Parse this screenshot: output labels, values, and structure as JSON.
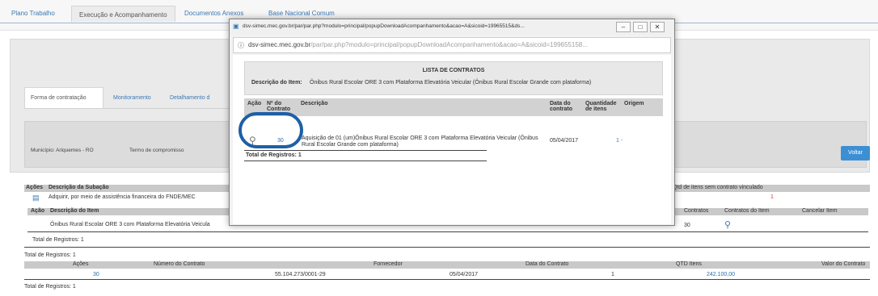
{
  "top_tabs": {
    "plano": "Plano Trabalho",
    "execucao": "Execução e Acompanhamento",
    "documentos": "Documentos Anexos",
    "base": "Base Nacional Comum"
  },
  "sub_tabs": {
    "forma": "Forma de contratação",
    "monitoramento": "Monitoramento",
    "detalhamento": "Detalhamento d"
  },
  "municipio_label": "Município: Ariquemes - RO",
  "termo_label": "Termo de compromisso",
  "voltar": "Voltar",
  "background_table": {
    "acoes_header": "Ações",
    "descricao_subacao_header": "Descrição da Subação",
    "subacao_text": "Adquirir, por meio de assistência financeira do FNDE/MEC",
    "acao_header": "Ação",
    "descricao_item_header": "Descrição do Item",
    "item_text": "Ônibus Rural Escolar ORE 3 com Plataforma Elevatória Veicula",
    "qtd_sem_contrato_header": "Qtd de itens sem contrato vinculado",
    "qtd_sem_contrato_value": "1",
    "contratos_header": "Contratos",
    "contratos_item_header": "Contratos do Item",
    "cancelar_item_header": "Cancelar Item",
    "contratos_value": "30",
    "total_inner": "Total de Registros: 1",
    "total_outer": "Total de Registros: 1",
    "columns": [
      "Ações",
      "Número do Contrato",
      "Fornecedor",
      "Data do Contrato",
      "QTD Itens",
      "Valor do Contrato"
    ],
    "contract_row": {
      "acao": "30",
      "cnpj": "55.104.273/0001-29",
      "data": "05/04/2017",
      "qtd": "1",
      "valor": "242.100,00"
    },
    "total_bottom": "Total de Registros: 1"
  },
  "modal": {
    "title": "dsv-simec.mec.gov.br/par/par.php?modulo=principal/popupDownloadAcompanhamento&acao=A&sicoid=19965515&ds...",
    "address_domain": "dsv-simec.mec.gov.br",
    "address_path": "/par/par.php?modulo=principal/popupDownloadAcompanhamento&acao=A&sicoid=199655158...",
    "list_title": "LISTA DE CONTRATOS",
    "desc_item_label": "Descrição do Item:",
    "desc_item_value": "Ônibus Rural Escolar ORE 3 com Plataforma Elevatória Veicular (Ônibus Rural Escolar Grande com plataforma)",
    "columns": {
      "acao": "Ação",
      "numero": "Nº do Contrato",
      "descricao": "Descrição",
      "data": "Data do contrato",
      "quantidade": "Quantidade de itens",
      "origem": "Origem"
    },
    "row": {
      "numero": "30",
      "descricao": "Aquisição de 01 (um)Ônibus Rural Escolar ORE 3 com Plataforma Elevatória Veicular (Ônibus Rural Escolar Grande com plataforma)",
      "data": "05/04/2017",
      "quantidade": "1",
      "origem": "1 -"
    },
    "total": "Total de Registros: 1"
  },
  "colors": {
    "link": "#2b6cb0",
    "highlight_oval": "#1e5fa6",
    "voltar_button": "#3d8fd4"
  }
}
